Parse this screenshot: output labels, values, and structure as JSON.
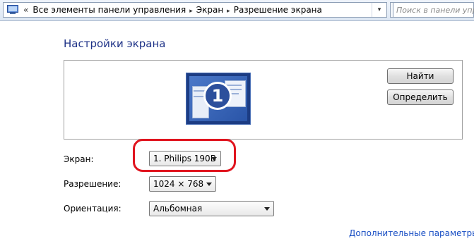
{
  "addressbar": {
    "leading_chevron": "«",
    "breadcrumb": [
      "Все элементы панели управления",
      "Экран",
      "Разрешение экрана"
    ],
    "separator": "▸",
    "history_dropdown": "▾",
    "search_placeholder": "Поиск в панели упр"
  },
  "page": {
    "title": "Настройки экрана"
  },
  "preview": {
    "monitor_number": "1",
    "buttons": {
      "find": "Найти",
      "identify": "Определить"
    }
  },
  "settings": {
    "screen": {
      "label": "Экран:",
      "value": "1. Philips 190B"
    },
    "resolution": {
      "label": "Разрешение:",
      "value": "1024 × 768"
    },
    "orientation": {
      "label": "Ориентация:",
      "value": "Альбомная"
    }
  },
  "links": {
    "advanced": "Дополнительные параметры"
  },
  "colors": {
    "title": "#1e3287",
    "link": "#1a4fc4",
    "highlight": "#e0141e"
  }
}
